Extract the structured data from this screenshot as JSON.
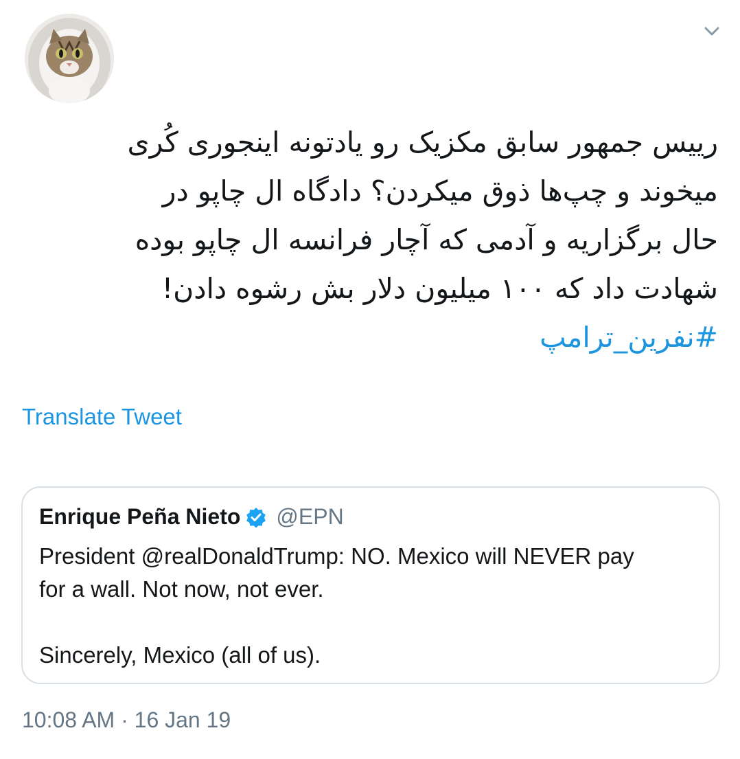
{
  "author": {
    "avatar_icon": "cat-avatar-icon"
  },
  "menu": {
    "caret_icon": "chevron-down-icon"
  },
  "tweet": {
    "lines": [
      "رییس جمهور سابق مکزیک رو یادتونه اینجوری کُری",
      "میخوند و چپ‌ها ذوق میکردن؟ دادگاه ال چاپو در",
      "حال برگزاریه و آدمی که آچار فرانسه ال چاپو بوده",
      "شهادت داد که ۱۰۰ میلیون دلار بش رشوه دادن!"
    ],
    "hashtag": "#نفرین_ترامپ",
    "translate_label": "Translate Tweet",
    "timestamp": "10:08 AM · 16 Jan 19"
  },
  "quoted_tweet": {
    "name": "Enrique Peña Nieto",
    "handle": "@EPN",
    "verified_icon": "verified-badge-icon",
    "lines": [
      "President @realDonaldTrump: NO. Mexico will NEVER pay",
      "for a wall. Not now, not ever."
    ],
    "closing": "Sincerely, Mexico (all of us)."
  },
  "colors": {
    "link": "#1b95e0",
    "text": "#14171a",
    "secondary": "#657786",
    "border": "#d8dfe5"
  }
}
